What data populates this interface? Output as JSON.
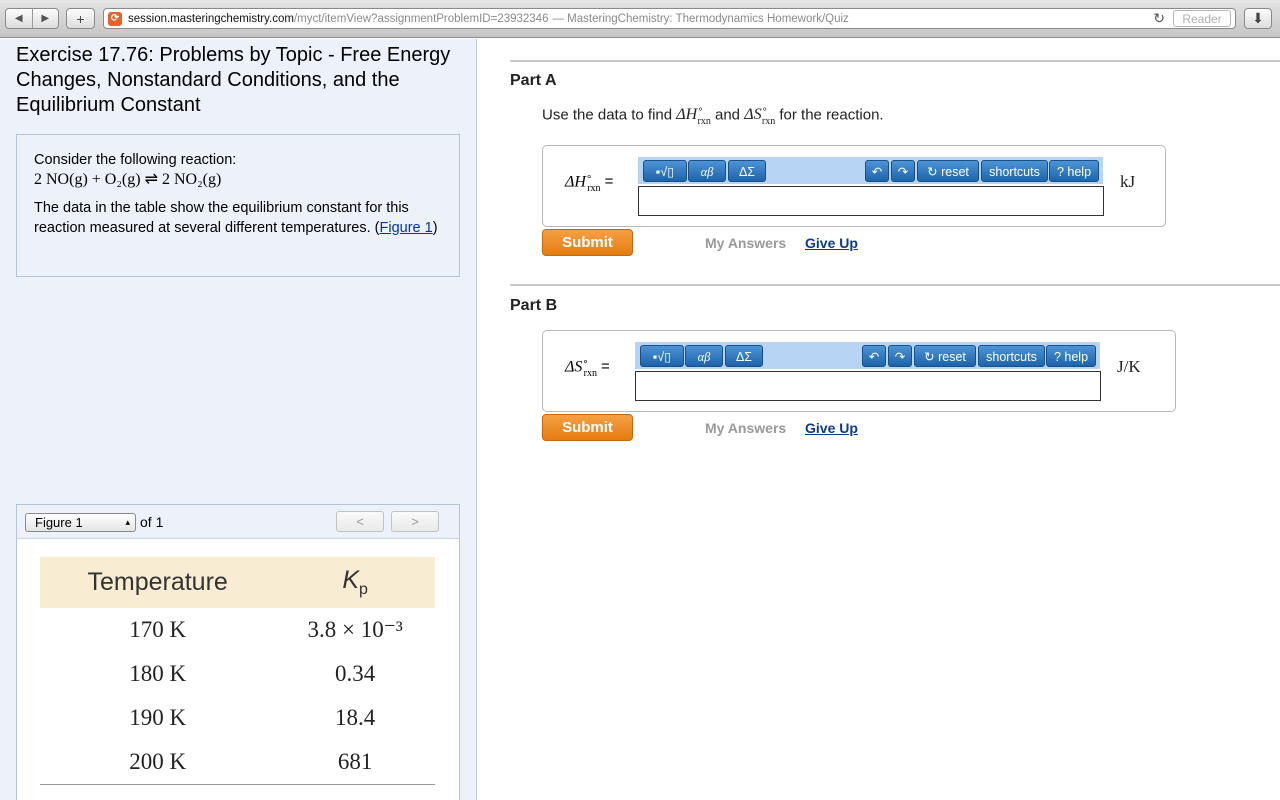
{
  "browser": {
    "url_host": "session.masteringchemistry.com",
    "url_path": "/myct/itemView?assignmentProblemID=23932346",
    "page_title": "— MasteringChemistry: Thermodynamics Homework/Quiz",
    "reader_label": "Reader"
  },
  "exercise": {
    "title": "Exercise 17.76: Problems by Topic - Free Energy Changes, Nonstandard Conditions, and the Equilibrium Constant",
    "intro": "Consider the following reaction:",
    "reaction": "2 NO(g) + O₂(g) ⇌ 2 NO₂(g)",
    "description": "The data in the table show the equilibrium constant for this reaction measured at several different temperatures.",
    "figure_link": "Figure 1"
  },
  "figure": {
    "selected": "Figure 1",
    "of_label": "of 1",
    "headers": [
      "Temperature",
      "Kp"
    ],
    "rows": [
      {
        "temp": "170 K",
        "kp": "3.8 × 10⁻³"
      },
      {
        "temp": "180 K",
        "kp": "0.34"
      },
      {
        "temp": "190 K",
        "kp": "18.4"
      },
      {
        "temp": "200 K",
        "kp": "681"
      }
    ]
  },
  "part_a": {
    "label": "Part A",
    "instruction_pre": "Use the data to find",
    "instruction_and": "and",
    "instruction_post": "for the reaction.",
    "unit": "kJ"
  },
  "part_b": {
    "label": "Part B",
    "unit": "J/K"
  },
  "editor": {
    "templates": "▪√▯",
    "greek": "αβ",
    "symbols": "ΔΣ",
    "reset": "reset",
    "shortcuts": "shortcuts",
    "help": "help"
  },
  "actions": {
    "submit": "Submit",
    "my_answers": "My Answers",
    "give_up": "Give Up"
  }
}
